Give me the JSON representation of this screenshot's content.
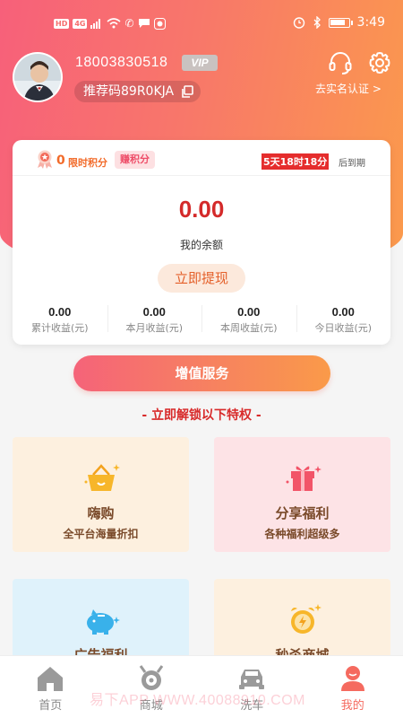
{
  "status_bar": {
    "chips": [
      "HD",
      "4G"
    ],
    "time": "3:49",
    "battery_level": 0.85
  },
  "profile": {
    "phone": "18003830518",
    "vip_label": "VIP",
    "referral": "推荐码89R0KJA",
    "verify_link": "去实名认证 >"
  },
  "card": {
    "points_value": "0",
    "points_label": "限时积分",
    "earn_button": "赚积分",
    "countdown": "5天18时18分",
    "expire_suffix": "后到期",
    "balance": "0.00",
    "balance_label": "我的余额",
    "withdraw_button": "立即提现",
    "stats": [
      {
        "value": "0.00",
        "label": "累计收益(元)"
      },
      {
        "value": "0.00",
        "label": "本月收益(元)"
      },
      {
        "value": "0.00",
        "label": "本周收益(元)"
      },
      {
        "value": "0.00",
        "label": "今日收益(元)"
      }
    ]
  },
  "value_service_button": "增值服务",
  "unlock_heading": "- 立即解锁以下特权 -",
  "features": [
    {
      "title": "嗨购",
      "subtitle": "全平台海量折扣",
      "bg": "#fdf0df",
      "icon": "basket-icon"
    },
    {
      "title": "分享福利",
      "subtitle": "各种福利超级多",
      "bg": "#fde3e6",
      "icon": "gift-icon"
    },
    {
      "title": "广告福利",
      "subtitle": "",
      "bg": "#dff2fb",
      "icon": "piggy-bank-icon"
    },
    {
      "title": "秒杀商城",
      "subtitle": "",
      "bg": "#fdf0df",
      "icon": "alarm-clock-icon"
    }
  ],
  "tabs": [
    {
      "label": "首页",
      "icon": "home-icon"
    },
    {
      "label": "商城",
      "icon": "mall-icon"
    },
    {
      "label": "洗车",
      "icon": "car-icon"
    },
    {
      "label": "我的",
      "icon": "person-icon"
    }
  ],
  "active_tab": "我的",
  "watermark": "易下APP WWW.40088910.COM",
  "colors": {
    "accent": "#f56a5f",
    "balance_red": "#d42a2a",
    "header_start": "#f7607a",
    "header_end": "#fb9a4c"
  }
}
